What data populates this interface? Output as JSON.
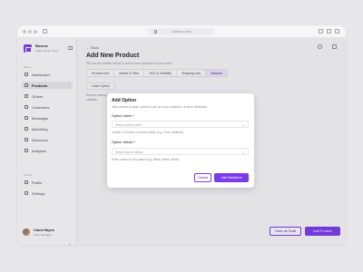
{
  "browser": {
    "url": "boxera.com"
  },
  "store": {
    "name": "Boxera",
    "subtitle": "Seller Panel / Sass"
  },
  "nav": {
    "section_menu": "Menu",
    "section_others": "Others",
    "items": [
      {
        "label": "Dashboard",
        "icon": "dashboard-icon"
      },
      {
        "label": "Products",
        "icon": "box-icon",
        "active": true
      },
      {
        "label": "Orders",
        "icon": "cart-icon"
      },
      {
        "label": "Customers",
        "icon": "users-icon"
      },
      {
        "label": "Messages",
        "icon": "chat-icon"
      },
      {
        "label": "Marketing",
        "icon": "megaphone-icon"
      },
      {
        "label": "Discounts",
        "icon": "tag-icon"
      },
      {
        "label": "Analytics",
        "icon": "chart-icon"
      }
    ],
    "others": [
      {
        "label": "Profile",
        "icon": "user-icon"
      },
      {
        "label": "Settings",
        "icon": "gear-icon"
      }
    ]
  },
  "user": {
    "name": "Ciara Hayes",
    "role": "Store Manager"
  },
  "main": {
    "back_label": "Back",
    "title": "Add New Product",
    "subtitle": "Fill out the details below to add a new product to your store.",
    "tabs": [
      {
        "label": "Product Info"
      },
      {
        "label": "Media & Files"
      },
      {
        "label": "SEO & Visibility"
      },
      {
        "label": "Shipping Info"
      },
      {
        "label": "Variants",
        "active": true
      }
    ],
    "add_option_label": "+ Add Option",
    "bg_text": "Start by adding variants.",
    "save_draft_label": "Save as Draft",
    "add_product_label": "Add Product"
  },
  "modal": {
    "title": "Add Option",
    "description": "Add custom product options such as color, material, or other attributes.",
    "option_name_label": "Option Name *",
    "option_name_placeholder": "Select option name",
    "option_name_hint": "Create or Choose a product option (e.g. Color, Material).",
    "option_values_label": "Option Values *",
    "option_values_placeholder": "Select option values",
    "option_values_hint": "Enter values for this option (e.g. Black, White, Silver).",
    "cancel_label": "Cancel",
    "add_label": "Add Variations"
  },
  "colors": {
    "accent": "#7c3aed",
    "accent_light": "#f0ecfb",
    "background": "#e8e8ea"
  }
}
